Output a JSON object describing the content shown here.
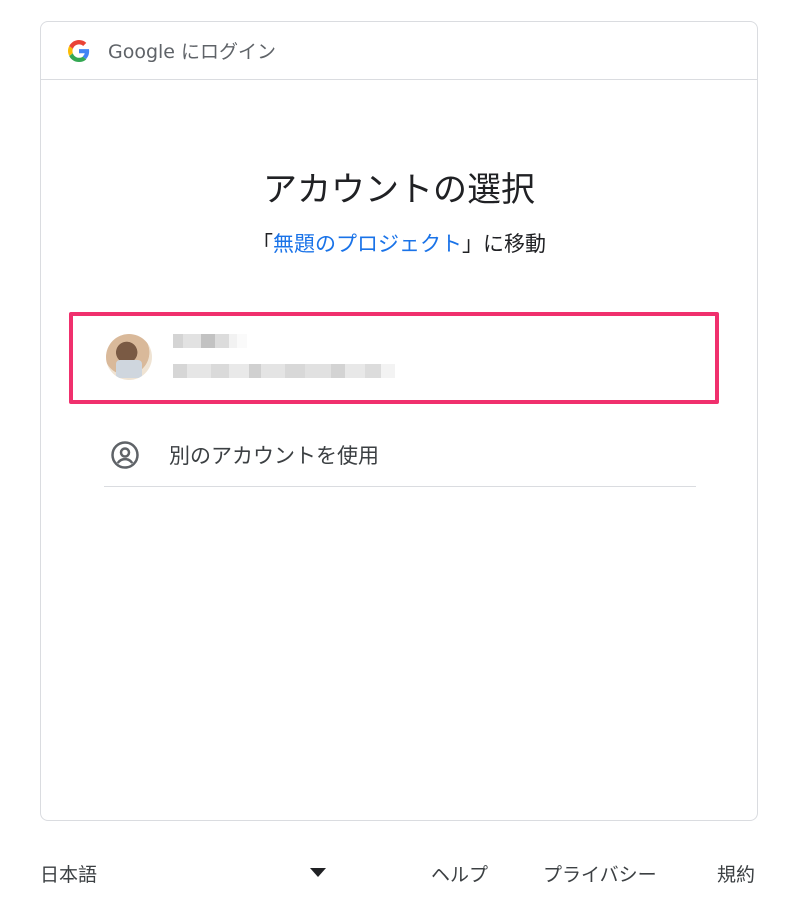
{
  "header": {
    "text": "Google にログイン"
  },
  "main": {
    "title": "アカウントの選択",
    "subtitle_prefix": "「",
    "subtitle_link": "無題のプロジェクト",
    "subtitle_suffix": "」に移動"
  },
  "accounts": [
    {
      "name": "",
      "email": "",
      "highlighted": true
    }
  ],
  "other_account": {
    "label": "別のアカウントを使用",
    "icon": "account-circle-icon"
  },
  "footer": {
    "language": "日本語",
    "help": "ヘルプ",
    "privacy": "プライバシー",
    "terms": "規約"
  },
  "colors": {
    "link": "#1a73e8",
    "highlight_border": "#f0306d",
    "divider": "#dadce0"
  }
}
